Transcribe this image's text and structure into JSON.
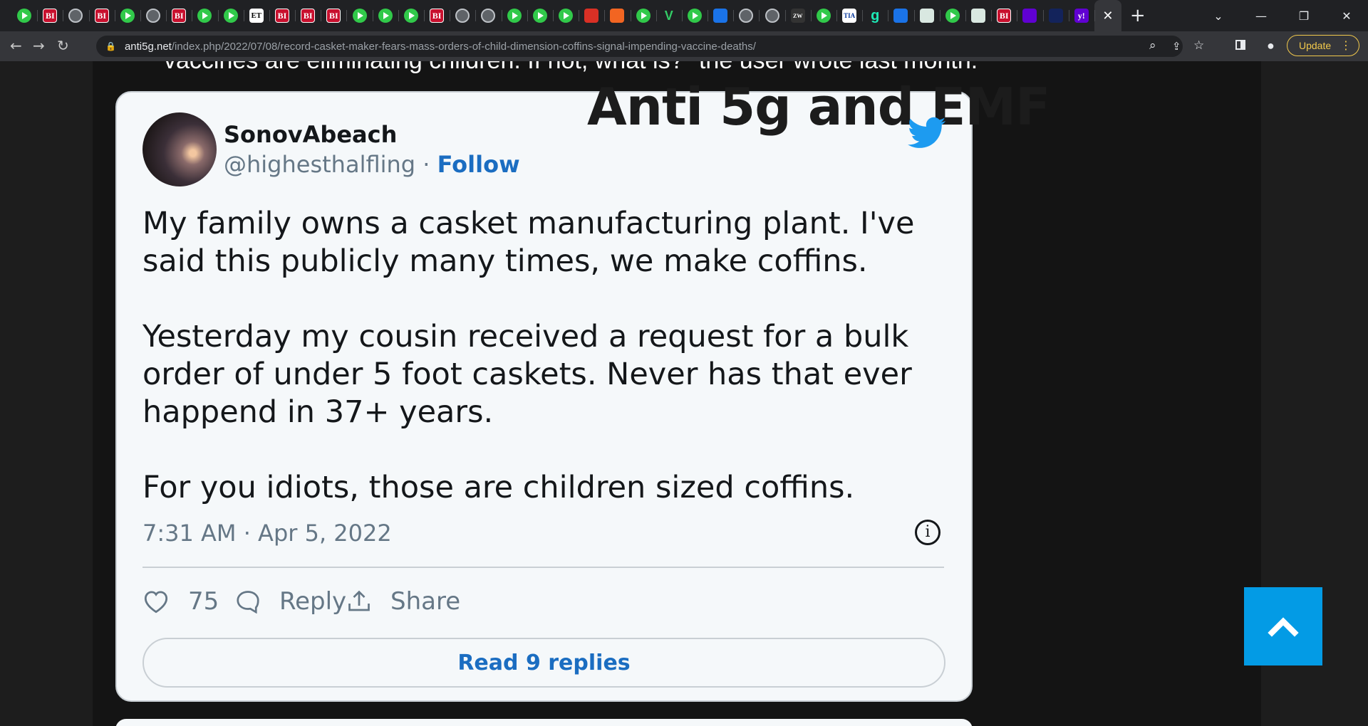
{
  "browser": {
    "tabs": [
      {
        "icon": "play-icon"
      },
      {
        "icon": "bi-icon",
        "text": "BI"
      },
      {
        "icon": "globe-icon"
      },
      {
        "icon": "bi-icon",
        "text": "BI"
      },
      {
        "icon": "play-icon"
      },
      {
        "icon": "globe-icon"
      },
      {
        "icon": "bi-icon",
        "text": "BI"
      },
      {
        "icon": "play-icon"
      },
      {
        "icon": "play-icon"
      },
      {
        "icon": "et-icon",
        "text": "ET"
      },
      {
        "icon": "bi-icon",
        "text": "BI"
      },
      {
        "icon": "bi-icon",
        "text": "BI"
      },
      {
        "icon": "bi-icon",
        "text": "BI"
      },
      {
        "icon": "play-icon"
      },
      {
        "icon": "play-icon"
      },
      {
        "icon": "play-icon"
      },
      {
        "icon": "bi-icon",
        "text": "BI"
      },
      {
        "icon": "globe-icon"
      },
      {
        "icon": "globe-icon"
      },
      {
        "icon": "play-icon"
      },
      {
        "icon": "play-icon"
      },
      {
        "icon": "play-icon"
      },
      {
        "icon": "red-icon"
      },
      {
        "icon": "orange-icon"
      },
      {
        "icon": "play-icon"
      },
      {
        "icon": "v-icon",
        "text": "V"
      },
      {
        "icon": "play-icon"
      },
      {
        "icon": "blue-icon"
      },
      {
        "icon": "globe-icon"
      },
      {
        "icon": "globe-icon"
      },
      {
        "icon": "dark-icon",
        "text": "ZW"
      },
      {
        "icon": "play-icon"
      },
      {
        "icon": "tia-icon",
        "text": "TIA"
      },
      {
        "icon": "g-icon",
        "text": "g"
      },
      {
        "icon": "blue-icon"
      },
      {
        "icon": "img-icon"
      },
      {
        "icon": "play-icon"
      },
      {
        "icon": "img-icon"
      },
      {
        "icon": "bi-icon",
        "text": "BI"
      },
      {
        "icon": "purple-icon"
      },
      {
        "icon": "navy-icon"
      },
      {
        "icon": "purple-icon",
        "text": "y!"
      }
    ],
    "url_host": "anti5g.net",
    "url_path": "/index.php/2022/07/08/record-casket-maker-fears-mass-orders-of-child-dimension-coffins-signal-impending-vaccine-deaths/",
    "update_label": "Update"
  },
  "page": {
    "cut_off_text": "vaccines are eliminating children. If not, what is?\" the user wrote last month.",
    "watermark": "Anti 5g and EMF"
  },
  "tweet": {
    "display_name": "SonovAbeach",
    "handle": "@highesthalfling",
    "separator": " · ",
    "follow_label": "Follow",
    "text": [
      "My family owns a casket manufacturing plant. I've said this publicly many times, we make coffins.",
      "Yesterday my cousin received a request for a bulk order of under 5 foot caskets. Never has that ever happend in 37+ years.",
      "For you idiots, those are children sized coffins."
    ],
    "timestamp": "7:31 AM · Apr 5, 2022",
    "like_count": "75",
    "reply_label": "Reply",
    "share_label": "Share",
    "read_replies_label": "Read 9 replies"
  },
  "colors": {
    "twitter_blue": "#1d9bf0",
    "link_blue": "#1b6dc1",
    "scroll_top_bg": "#039be5"
  }
}
